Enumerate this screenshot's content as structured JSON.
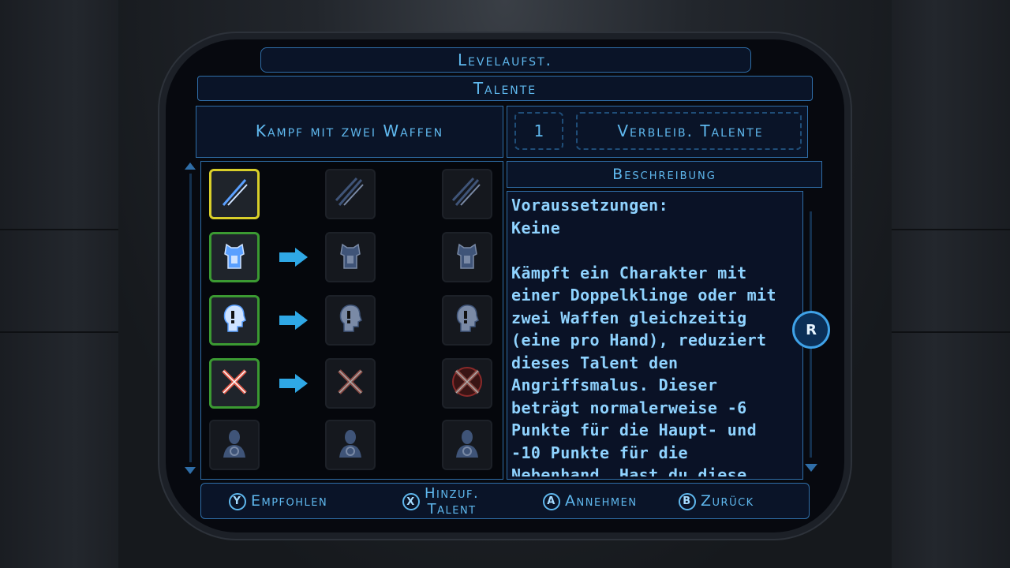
{
  "screen_title": "Levelaufst.",
  "section_title": "Talente",
  "category": "Kampf mit zwei Waffen",
  "remaining": {
    "count": "1",
    "label": "Verbleib. Talente"
  },
  "description_header": "Beschreibung",
  "description_text": "Voraussetzungen:\nKeine\n\nKämpft ein Charakter mit einer Doppelklinge oder mit zwei Waffen gleichzeitig (eine pro Hand), reduziert dieses Talent den Angriffsmalus. Dieser beträgt normalerweise -6 Punkte für die Haupt- und -10 Punkte für die Nebenhand. Hast du diese",
  "scroll_button": "R",
  "talent_rows": [
    {
      "icons": [
        "twin-swords-icon",
        "triple-swords-icon",
        "claw-swords-icon"
      ],
      "state": "selected",
      "arrow": false
    },
    {
      "icons": [
        "armor-vest-icon",
        "armor-plate-icon",
        "armor-suit-icon"
      ],
      "state": "owned",
      "arrow": true
    },
    {
      "icons": [
        "alert-head-icon",
        "sound-head-icon",
        "shield-head-icon"
      ],
      "state": "owned",
      "arrow": true
    },
    {
      "icons": [
        "crossed-blades-icon",
        "crossed-blades-shield-icon",
        "crossed-blades-round-icon"
      ],
      "state": "owned",
      "arrow": true
    },
    {
      "icons": [
        "droid-bust-icon",
        "droid-bust-ring-icon",
        "droid-bust-glow-icon"
      ],
      "state": "locked",
      "arrow": false
    }
  ],
  "footer": {
    "recommended": {
      "key": "Y",
      "label": "Empfohlen"
    },
    "add_talent": {
      "key": "X",
      "label_line1": "Hinzuf.",
      "label_line2": "Talent"
    },
    "accept": {
      "key": "A",
      "label": "Annehmen"
    },
    "back": {
      "key": "B",
      "label": "Zurück"
    }
  },
  "colors": {
    "accent": "#5fb8ee",
    "selected_border": "#d8cf2a",
    "owned_border": "#3b9a32",
    "arrow": "#2fa8e6"
  }
}
